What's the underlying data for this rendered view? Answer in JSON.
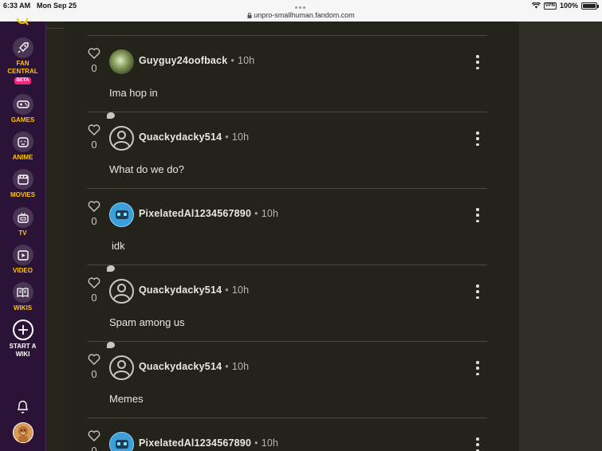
{
  "status_bar": {
    "time": "6:33 AM",
    "date": "Mon Sep 25",
    "url": "unpro-smallhuman.fandom.com",
    "battery": "100%"
  },
  "rail": {
    "items": [
      {
        "label_line1": "FAN",
        "label_line2": "CENTRAL",
        "badge": "BETA",
        "icon": "rocket-icon"
      },
      {
        "label_line1": "GAMES",
        "icon": "gamepad-icon"
      },
      {
        "label_line1": "ANIME",
        "icon": "anime-face-icon"
      },
      {
        "label_line1": "MOVIES",
        "icon": "clapperboard-icon"
      },
      {
        "label_line1": "TV",
        "icon": "tv-icon"
      },
      {
        "label_line1": "VIDEO",
        "icon": "play-icon"
      },
      {
        "label_line1": "WIKIS",
        "icon": "book-icon"
      },
      {
        "label_line1": "START A",
        "label_line2": "WIKI",
        "icon": "plus-icon"
      }
    ]
  },
  "replies": [
    {
      "username": "Guyguy24oofback",
      "time": "10h",
      "likes": "0",
      "text": "Ima hop in",
      "avatar": "photo"
    },
    {
      "username": "Quackydacky514",
      "time": "10h",
      "likes": "0",
      "text": "What do we do?",
      "avatar": "default"
    },
    {
      "username": "PixelatedAl1234567890",
      "time": "10h",
      "likes": "0",
      "text": "idk",
      "avatar": "bot"
    },
    {
      "username": "Quackydacky514",
      "time": "10h",
      "likes": "0",
      "text": "Spam among us",
      "avatar": "default"
    },
    {
      "username": "Quackydacky514",
      "time": "10h",
      "likes": "0",
      "text": "Memes",
      "avatar": "default"
    },
    {
      "username": "PixelatedAl1234567890",
      "time": "10h",
      "likes": "0",
      "text": "",
      "avatar": "bot"
    }
  ],
  "colors": {
    "rail_bg": "#2a1336",
    "rail_accent": "#ffc500",
    "beta_badge": "#f0297b",
    "main_bg": "#23221b"
  }
}
